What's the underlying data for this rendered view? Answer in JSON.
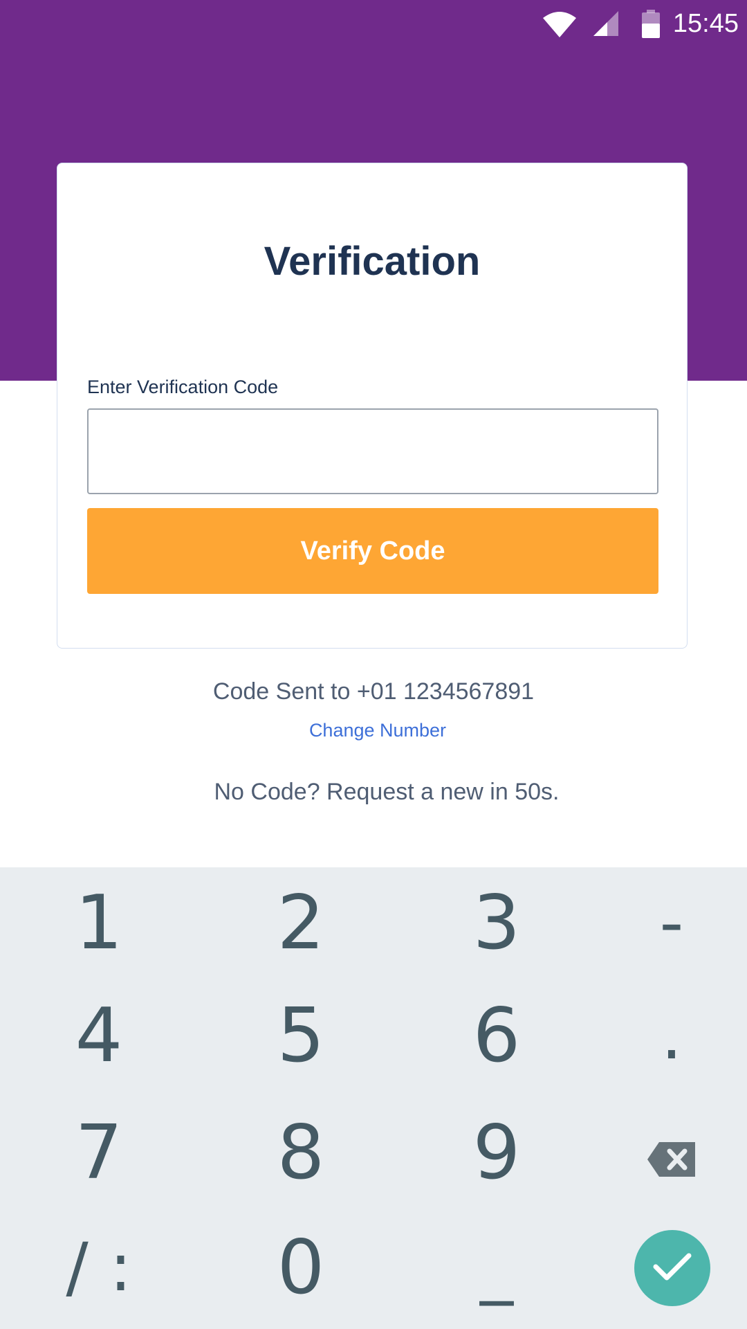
{
  "status_bar": {
    "time": "15:45"
  },
  "colors": {
    "header_purple": "#702a8b",
    "button_orange": "#fea634",
    "title_navy": "#1f3352",
    "link_blue": "#3d6fd8",
    "keypad_bg": "#e9edf0",
    "done_teal": "#4db6ac"
  },
  "card": {
    "title": "Verification",
    "field_label": "Enter Verification Code",
    "input_value": "",
    "button_label": "Verify Code"
  },
  "info": {
    "code_sent": "Code Sent to +01 1234567891",
    "change_number": "Change Number",
    "resend": "No Code? Request a new in 50s."
  },
  "keypad": {
    "keys": [
      "1",
      "2",
      "3",
      "-",
      "4",
      "5",
      "6",
      ".",
      "7",
      "8",
      "9",
      "backspace-icon",
      "/ :",
      "0",
      "_",
      "check-icon"
    ]
  }
}
